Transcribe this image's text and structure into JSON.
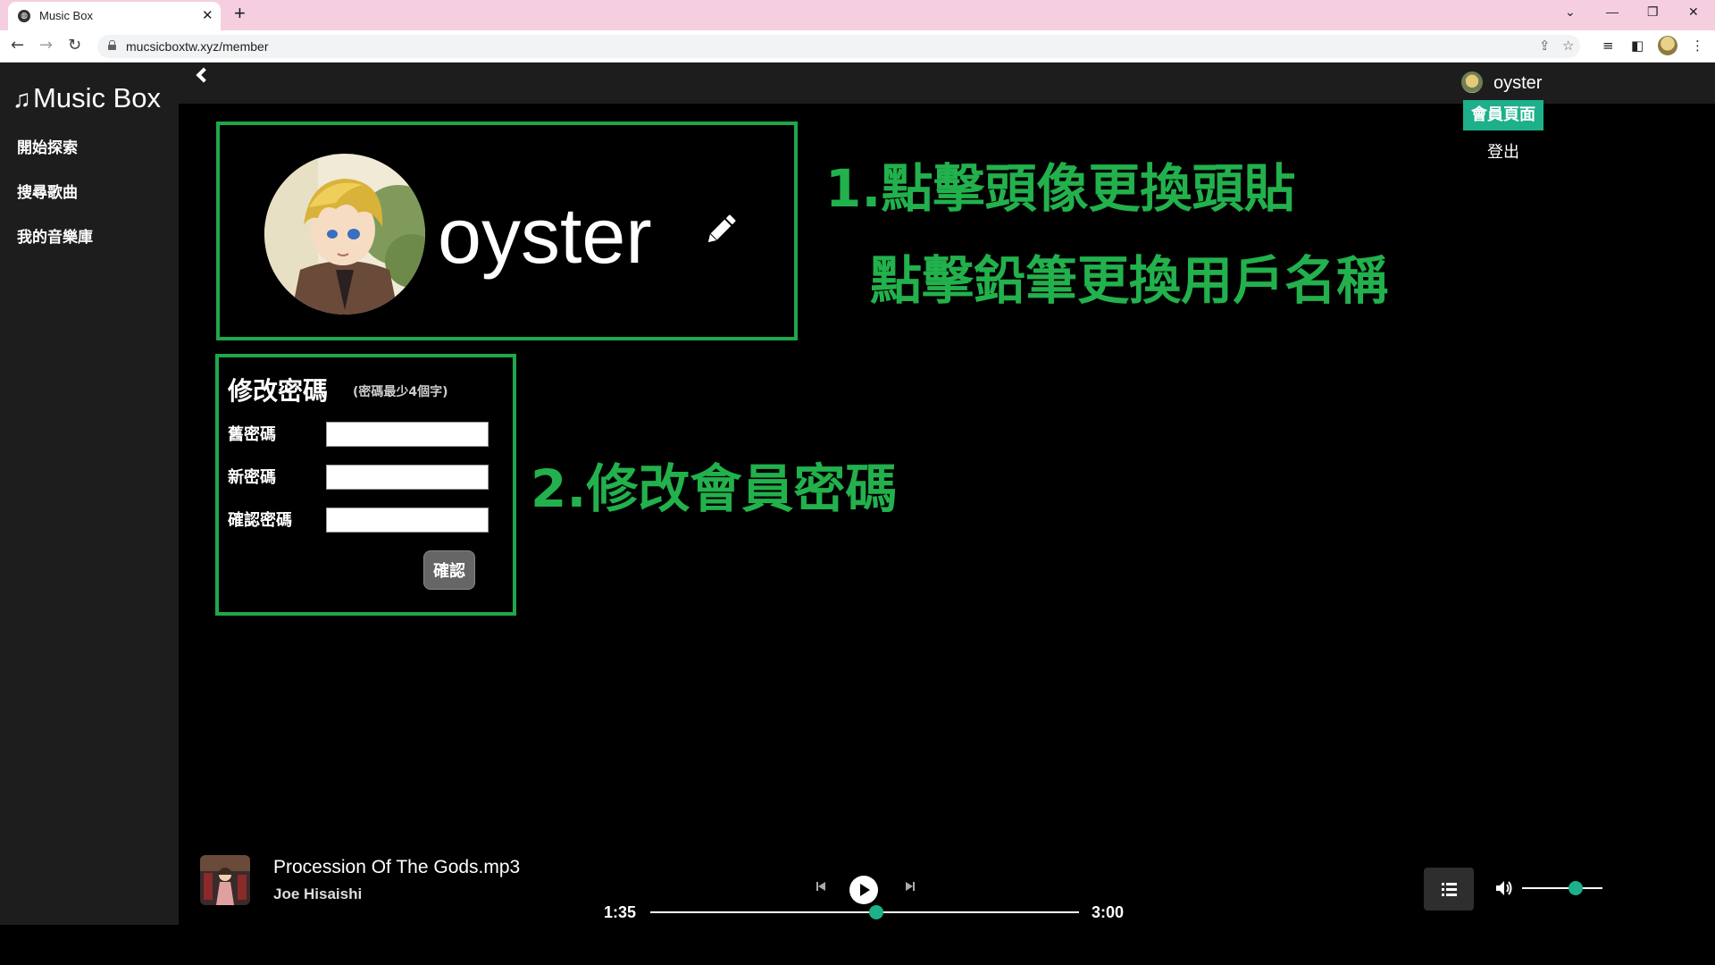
{
  "browser": {
    "tab_title": "Music Box",
    "tab_favicon": "globe-icon",
    "url": "mucsicboxtw.xyz/member"
  },
  "app": {
    "logo": "Music Box",
    "nav": [
      {
        "label": "開始探索",
        "icon": "none"
      },
      {
        "label": "搜尋歌曲",
        "icon": "none"
      },
      {
        "label": "我的音樂庫",
        "icon": "none"
      }
    ]
  },
  "user_menu": {
    "username": "oyster",
    "member_page": "會員頁面",
    "logout": "登出"
  },
  "profile": {
    "username": "oyster",
    "edit_icon": "pencil-icon"
  },
  "annotations": {
    "line1": "1.點擊頭像更換頭貼",
    "line2": "點擊鉛筆更換用戶名稱",
    "line3": "2.修改會員密碼",
    "color": "#22b14c"
  },
  "password_form": {
    "title": "修改密碼",
    "hint": "(密碼最少4個字)",
    "fields": [
      {
        "label": "舊密碼",
        "value": ""
      },
      {
        "label": "新密碼",
        "value": ""
      },
      {
        "label": "確認密碼",
        "value": ""
      }
    ],
    "submit": "確認"
  },
  "player": {
    "song_title": "Procession Of The Gods.mp3",
    "artist": "Joe Hisaishi",
    "current_time": "1:35",
    "total_time": "3:00",
    "progress_fraction": 0.528,
    "volume_fraction": 0.67,
    "accent_color": "#1db08a"
  }
}
